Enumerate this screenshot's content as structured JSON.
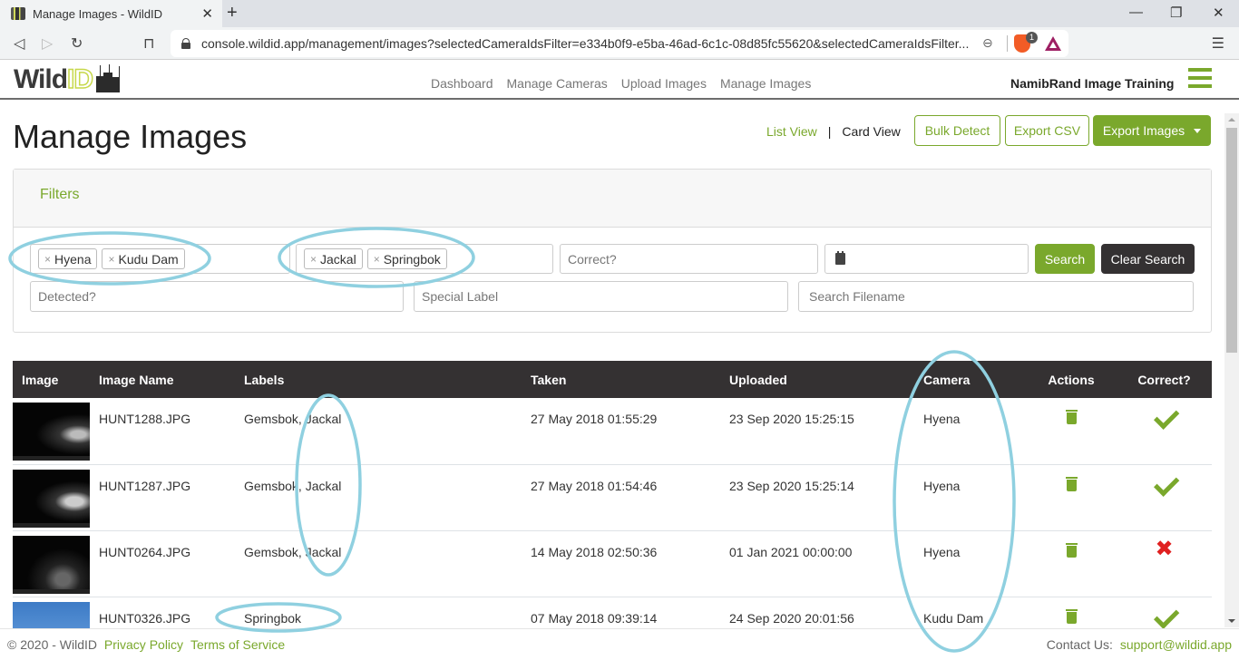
{
  "browser": {
    "tab_title": "Manage Images - WildID",
    "url": "console.wildid.app/management/images?selectedCameraIdsFilter=e334b0f9-e5ba-46ad-6c1c-08d85fc55620&selectedCameraIdsFilter...",
    "shield_badge": "1"
  },
  "header": {
    "logo_wild": "Wild",
    "logo_id": "ID",
    "nav": [
      "Dashboard",
      "Manage Cameras",
      "Upload Images",
      "Manage Images"
    ],
    "org_name": "NamibRand Image Training"
  },
  "page": {
    "title": "Manage Images",
    "list_view": "List View",
    "divider": "|",
    "card_view": "Card View",
    "bulk_detect": "Bulk Detect",
    "export_csv": "Export CSV",
    "export_images": "Export Images"
  },
  "filters": {
    "heading": "Filters",
    "camera_chips": [
      "Hyena",
      "Kudu Dam"
    ],
    "label_chips": [
      "Jackal",
      "Springbok"
    ],
    "correct_placeholder": "Correct?",
    "date_value": "",
    "search_button": "Search",
    "clear_button": "Clear Search",
    "detected_placeholder": "Detected?",
    "special_label_placeholder": "Special Label",
    "filename_placeholder": "Search Filename",
    "chip_remove": "×"
  },
  "table": {
    "headers": [
      "Image",
      "Image Name",
      "Labels",
      "Taken",
      "Uploaded",
      "Camera",
      "Actions",
      "Correct?"
    ],
    "rows": [
      {
        "name": "HUNT1288.JPG",
        "labels": "Gemsbok, Jackal",
        "taken": "27 May 2018 01:55:29",
        "uploaded": "23 Sep 2020 15:25:15",
        "camera": "Hyena",
        "correct": true
      },
      {
        "name": "HUNT1287.JPG",
        "labels": "Gemsbok, Jackal",
        "taken": "27 May 2018 01:54:46",
        "uploaded": "23 Sep 2020 15:25:14",
        "camera": "Hyena",
        "correct": true
      },
      {
        "name": "HUNT0264.JPG",
        "labels": "Gemsbok, Jackal",
        "taken": "14 May 2018 02:50:36",
        "uploaded": "01 Jan 2021 00:00:00",
        "camera": "Hyena",
        "correct": false
      },
      {
        "name": "HUNT0326.JPG",
        "labels": "Springbok",
        "taken": "07 May 2018 09:39:14",
        "uploaded": "24 Sep 2020 20:01:56",
        "camera": "Kudu Dam",
        "correct": true
      }
    ]
  },
  "footer": {
    "copyright": "© 2020 - WildID",
    "privacy": "Privacy Policy",
    "terms": "Terms of Service",
    "contact_label": "Contact Us:",
    "contact_email": "support@wildid.app"
  },
  "colors": {
    "accent": "#7aa82c",
    "table_header": "#343132",
    "error": "#e02020",
    "annotation": "#8fd0e0"
  }
}
